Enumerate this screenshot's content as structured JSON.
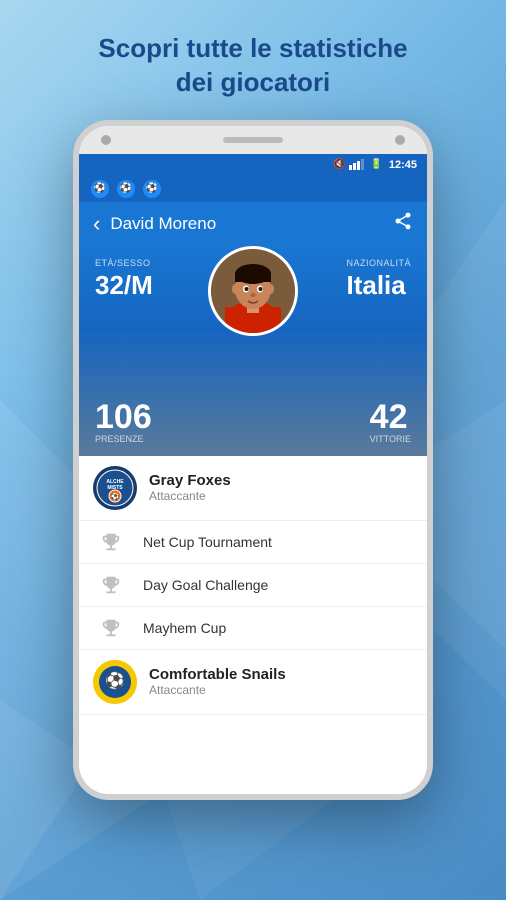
{
  "page": {
    "background": "light-blue-gradient",
    "header": {
      "line1": "Scopri tutte le statistiche",
      "line2": "dei giocatori"
    }
  },
  "status_bar": {
    "time": "12:45",
    "mute": true,
    "signal": 3,
    "battery": 60
  },
  "app_icons": [
    {
      "label": "⚽",
      "name": "soccer-ball-icon"
    },
    {
      "label": "⚽",
      "name": "soccer-ball-icon-2"
    },
    {
      "label": "⚽",
      "name": "soccer-ball-icon-3"
    }
  ],
  "nav": {
    "back_label": "‹",
    "title": "David Moreno",
    "share_label": "⬆"
  },
  "stats": {
    "age_label": "ETÀ/SESSO",
    "age_value": "32/M",
    "nationality_label": "NAZIONALITÀ",
    "nationality_value": "Italia",
    "presenze_value": "106",
    "presenze_label": "PRESENZE",
    "vittorie_value": "42",
    "vittorie_label": "VITTORIE"
  },
  "team1": {
    "name": "Gray Foxes",
    "role": "Attaccante",
    "logo_text": "ALCHEMISTS"
  },
  "trophies": [
    {
      "name": "Net Cup Tournament",
      "icon": "🏆"
    },
    {
      "name": "Day Goal Challenge",
      "icon": "🏆"
    },
    {
      "name": "Mayhem Cup",
      "icon": "🏆"
    }
  ],
  "team2": {
    "name": "Comfortable Snails",
    "role": "Attaccante",
    "logo_color": "#f5c500"
  }
}
